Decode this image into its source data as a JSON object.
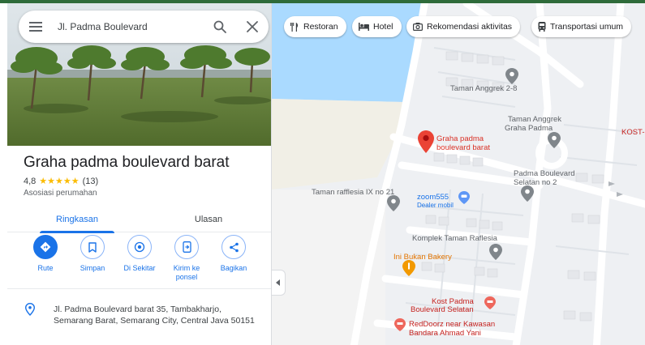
{
  "search": {
    "query": "Jl. Padma Boulevard"
  },
  "place": {
    "title": "Graha padma boulevard barat",
    "rating": "4,8",
    "stars": "★★★★★",
    "reviews": "(13)",
    "category": "Asosiasi perumahan",
    "address": "Jl. Padma Boulevard barat 35, Tambakharjo, Semarang Barat, Semarang City, Central Java 50151"
  },
  "tabs": [
    {
      "label": "Ringkasan"
    },
    {
      "label": "Ulasan"
    }
  ],
  "actions": [
    {
      "label": "Rute",
      "icon": "directions-icon"
    },
    {
      "label": "Simpan",
      "icon": "bookmark-icon"
    },
    {
      "label": "Di Sekitar",
      "icon": "nearby-icon"
    },
    {
      "label": "Kirim ke ponsel",
      "icon": "send-to-phone-icon"
    },
    {
      "label": "Bagikan",
      "icon": "share-icon"
    }
  ],
  "chips": [
    {
      "label": "Restoran",
      "icon": "restaurant-icon"
    },
    {
      "label": "Hotel",
      "icon": "hotel-icon"
    },
    {
      "label": "Rekomendasi aktivitas",
      "icon": "camera-icon"
    },
    {
      "label": "Transportasi umum",
      "icon": "transit-icon"
    }
  ],
  "map_labels": {
    "taman_anggrek_2": "Taman Anggrek 2-8",
    "taman_anggrek_graha_1": "Taman Anggrek",
    "taman_anggrek_graha_2": "Graha Padma",
    "selected_place_1": "Graha padma",
    "selected_place_2": "boulevard barat",
    "kost_edge": "KOST-",
    "padma_selatan_1": "Padma Boulevard",
    "padma_selatan_2": "Selatan no 2",
    "taman_rafflesia": "Taman rafflesia IX no 21",
    "zoom555": "zoom555",
    "zoom555_sub": "Dealer mobil",
    "komplek": "Komplek Taman Raflesia",
    "bakery": "Ini Bukan Bakery",
    "kost_padma_1": "Kost Padma",
    "kost_padma_2": "Boulevard Selatan",
    "reddoorz_1": "RedDoorz near Kawasan",
    "reddoorz_2": "Bandara Ahmad Yani"
  },
  "colors": {
    "accent": "#1a73e8",
    "selected_pin": "#ea4335",
    "star": "#fbbc04",
    "water": "#aadaff"
  }
}
